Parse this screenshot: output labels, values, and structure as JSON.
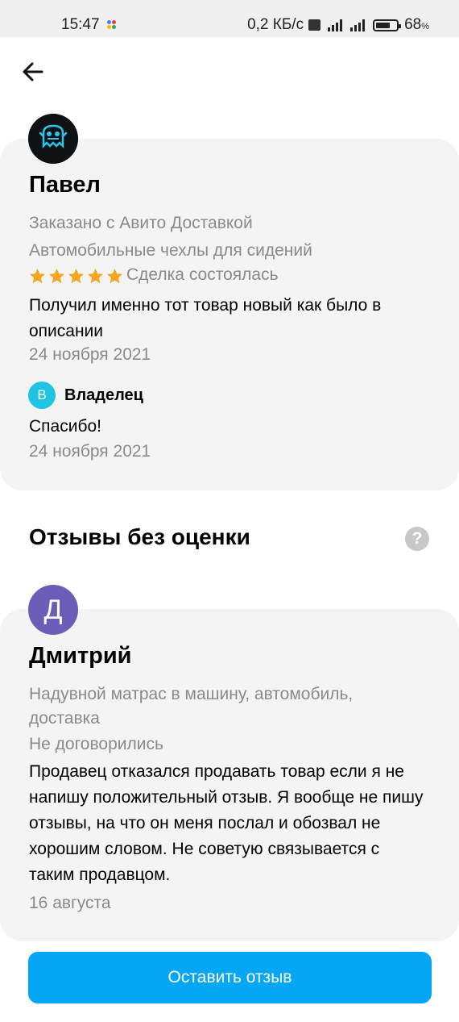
{
  "status_bar": {
    "time": "15:47",
    "network_speed": "0,2 КБ/с",
    "network_type": "4G+",
    "battery_percent": "68",
    "battery_unit": "%"
  },
  "review_main": {
    "author": "Павел",
    "delivery_type": "Заказано с Авито Доставкой",
    "item": "Автомобильные чехлы для сидений",
    "rating": 5,
    "deal_status": "Сделка состоялась",
    "text": "Получил именно тот товар новый как было в описании",
    "date": "24 ноября 2021",
    "reply": {
      "avatar_letter": "В",
      "author": "Владелец",
      "text": "Спасибо!",
      "date": "24 ноября 2021"
    }
  },
  "section": {
    "title": "Отзывы без оценки",
    "help_icon": "?"
  },
  "review_unrated": {
    "avatar_letter": "Д",
    "author": "Дмитрий",
    "item": "Надувной матрас в машину, автомобиль, доставка",
    "deal_status": "Не договорились",
    "text": "Продавец отказался продавать товар если я не напишу положительный отзыв. Я вообще не пишу отзывы, на что он меня послал и обозвал не хорошим словом. Не советую связывается с таким продавцом.",
    "date": "16 августа"
  },
  "cta": {
    "label": "Оставить отзыв"
  },
  "colors": {
    "accent": "#05a7f5",
    "star": "#f5a623",
    "card_bg": "#f4f4f4",
    "secondary_text": "#8a8a8a",
    "owner_avatar": "#1fc3e4",
    "user_avatar": "#6a5fb8"
  },
  "icons": {
    "back": "arrow-left-icon",
    "help": "question-circle-icon",
    "star": "star-icon"
  }
}
